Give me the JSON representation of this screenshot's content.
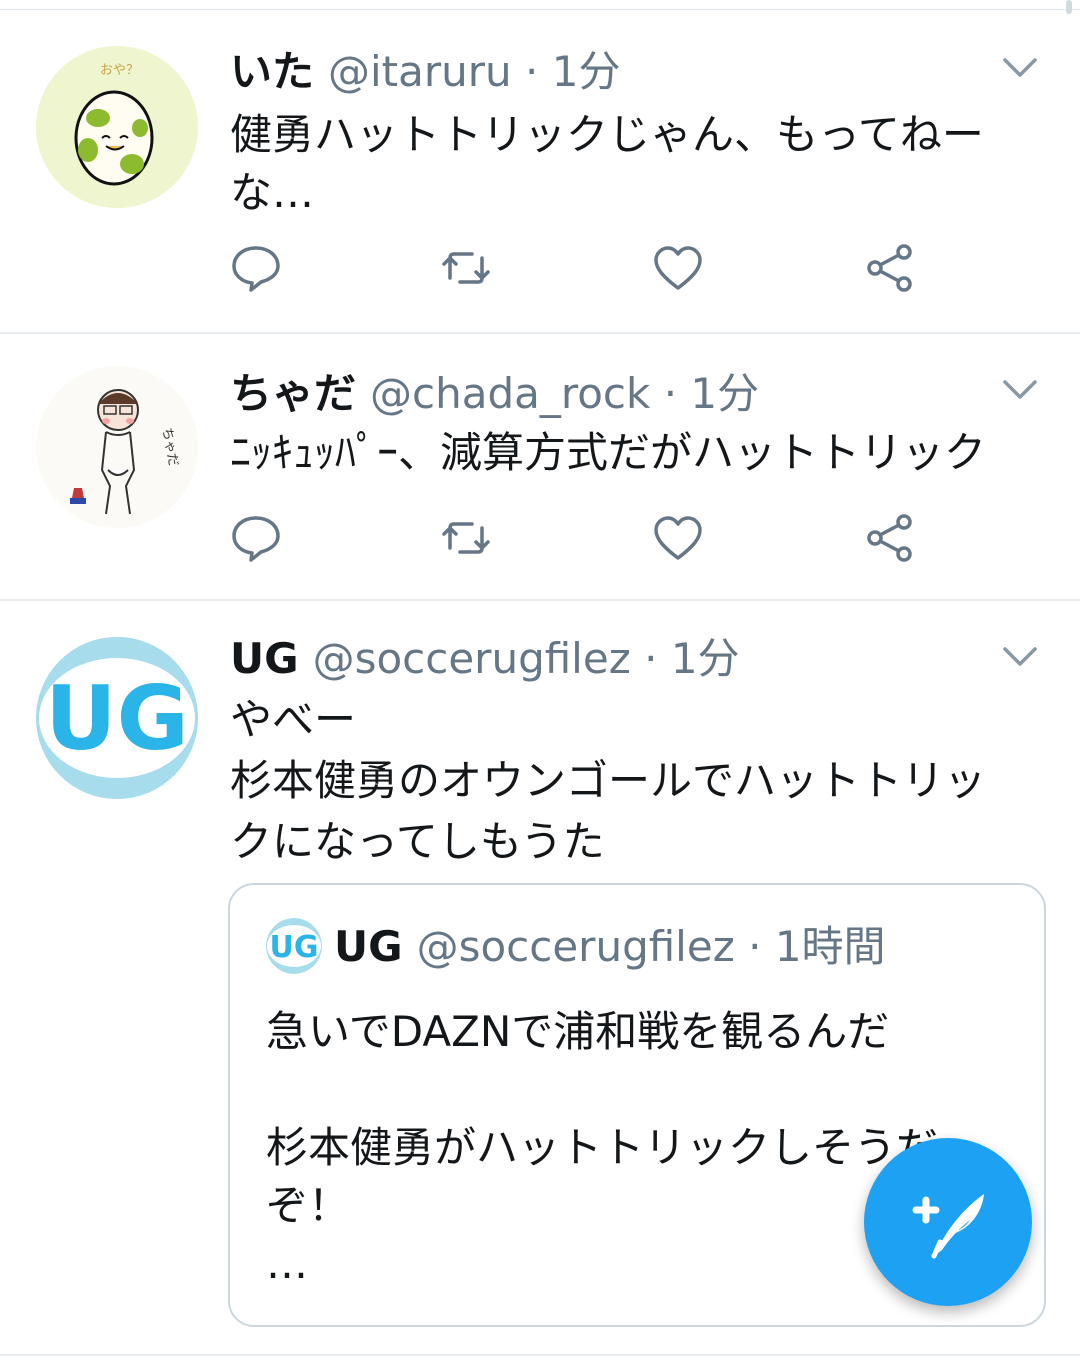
{
  "colors": {
    "accent": "#1da1f2",
    "text": "#14171a",
    "secondary": "#657786",
    "divider": "#e6ecf0"
  },
  "tweets": [
    {
      "display_name": "いた",
      "handle": "@itaruru",
      "sep": "·",
      "time": "1分",
      "text": "健勇ハットトリックじゃん、もってねー\nな…",
      "avatar_caption": "おや？"
    },
    {
      "display_name": "ちゃだ",
      "handle": "@chada_rock",
      "sep": "·",
      "time": "1分",
      "text": "ﾆｯｷｭｯﾊﾟｰ、減算方式だがハットトリック",
      "avatar_caption": "ちゃだ"
    },
    {
      "display_name": "UG",
      "handle": "@soccerugfilez",
      "sep": "·",
      "time": "1分",
      "text": "やべー\n杉本健勇のオウンゴールでハットトリッ\nクになってしもうた",
      "avatar_text": "UG",
      "quote": {
        "avatar_text": "UG",
        "display_name": "UG",
        "handle": "@soccerugfilez",
        "sep": "·",
        "time": "1時間",
        "text": "急いでDAZNで浦和戦を観るんだ\n\n杉本健勇がハットトリックしそうだ\nぞ！\n…"
      }
    }
  ],
  "icons": {
    "reply": "reply-icon",
    "retweet": "retweet-icon",
    "like": "heart-icon",
    "share": "share-icon",
    "menu": "chevron-down-icon",
    "compose": "compose-tweet-icon"
  }
}
